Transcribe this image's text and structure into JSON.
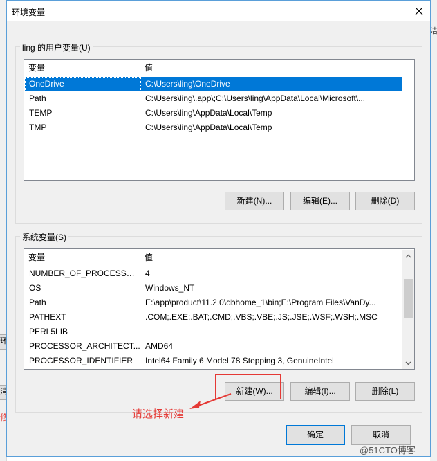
{
  "dialog": {
    "title": "环境变量",
    "close_glyph": "✕"
  },
  "user_vars": {
    "group_label": "ling 的用户变量(U)",
    "headers": [
      "变量",
      "值"
    ],
    "rows": [
      {
        "name": "OneDrive",
        "value": "C:\\Users\\ling\\OneDrive",
        "selected": true
      },
      {
        "name": "Path",
        "value": "C:\\Users\\ling\\.app\\;C:\\Users\\ling\\AppData\\Local\\Microsoft\\..."
      },
      {
        "name": "TEMP",
        "value": "C:\\Users\\ling\\AppData\\Local\\Temp"
      },
      {
        "name": "TMP",
        "value": "C:\\Users\\ling\\AppData\\Local\\Temp"
      }
    ],
    "buttons": {
      "new": "新建(N)...",
      "edit": "编辑(E)...",
      "delete": "删除(D)"
    }
  },
  "system_vars": {
    "group_label": "系统变量(S)",
    "headers": [
      "变量",
      "值"
    ],
    "rows": [
      {
        "name": "NUMBER_OF_PROCESSORS",
        "value": "4"
      },
      {
        "name": "OS",
        "value": "Windows_NT"
      },
      {
        "name": "Path",
        "value": "E:\\app\\product\\11.2.0\\dbhome_1\\bin;E:\\Program Files\\VanDy..."
      },
      {
        "name": "PATHEXT",
        "value": ".COM;.EXE;.BAT;.CMD;.VBS;.VBE;.JS;.JSE;.WSF;.WSH;.MSC"
      },
      {
        "name": "PERL5LIB",
        "value": ""
      },
      {
        "name": "PROCESSOR_ARCHITECT...",
        "value": "AMD64"
      },
      {
        "name": "PROCESSOR_IDENTIFIER",
        "value": "Intel64 Family 6 Model 78 Stepping 3, GenuineIntel"
      }
    ],
    "buttons": {
      "new": "新建(W)...",
      "edit": "编辑(I)...",
      "delete": "删除(L)"
    }
  },
  "footer": {
    "ok": "确定",
    "cancel": "取消"
  },
  "annotation": {
    "text": "请选择新建",
    "color": "#e53935"
  },
  "background": {
    "right_text": "洁",
    "left_btn_1": "环",
    "left_btn_2": "消",
    "left_text": "修"
  },
  "watermark": "@51CTO博客",
  "colors": {
    "selection": "#0078d7",
    "default_border": "#0078d7",
    "annotation": "#e53935"
  }
}
